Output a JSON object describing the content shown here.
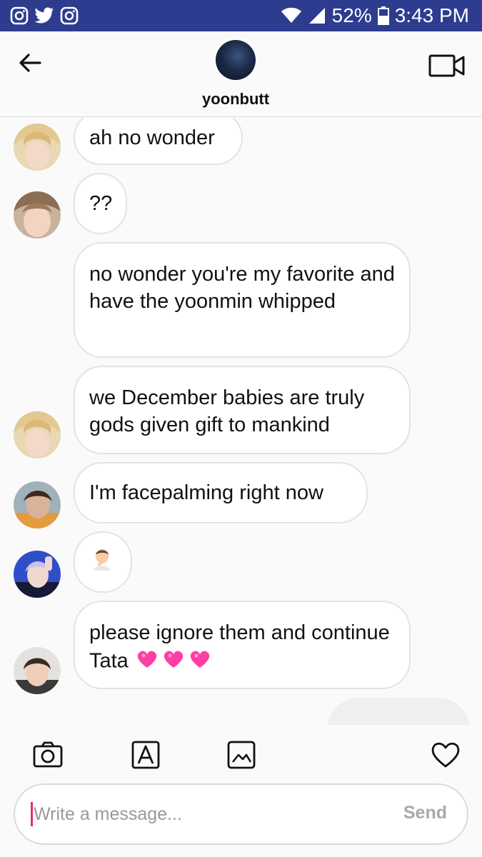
{
  "status_bar": {
    "battery": "52%",
    "time": "3:43 PM",
    "left_icons": [
      "instagram-icon",
      "twitter-icon",
      "instagram-icon"
    ],
    "right_icons": [
      "wifi-icon",
      "cell-signal-icon",
      "battery-icon"
    ]
  },
  "header": {
    "username": "yoonbutt",
    "back_icon": "back-arrow-icon",
    "video_icon": "video-camera-icon"
  },
  "messages": [
    {
      "text": "ah no wonder"
    },
    {
      "text": "??"
    },
    {
      "text": "no wonder you're my favorite and have the yoonmin whipped"
    },
    {
      "text": "we December babies are truly gods given gift to mankind"
    },
    {
      "text": "I'm facepalming right now"
    },
    {
      "text": "",
      "emoji": "person-facepalming-emoji"
    },
    {
      "text": "please ignore them and continue Tata",
      "emoji": "two-hearts-emoji"
    }
  ],
  "composer": {
    "placeholder": "Write a message...",
    "send_label": "Send"
  },
  "toolbar_icons": [
    "camera-icon",
    "text-format-icon",
    "gallery-icon",
    "heart-icon"
  ],
  "colors": {
    "status_bar": "#2d3c8f",
    "bubble_border": "#e3e3e3",
    "cursor": "#e1306c"
  }
}
